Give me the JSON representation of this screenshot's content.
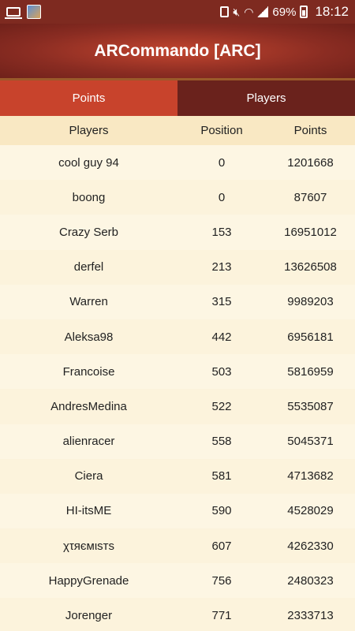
{
  "status_bar": {
    "battery": "69%",
    "time": "18:12"
  },
  "header": {
    "title": "ARCommando [ARC]"
  },
  "tabs": [
    {
      "label": "Points",
      "active": true
    },
    {
      "label": "Players",
      "active": false
    }
  ],
  "table": {
    "columns": [
      "Players",
      "Position",
      "Points"
    ],
    "rows": [
      {
        "player": "cool guy 94",
        "position": "0",
        "points": "1201668"
      },
      {
        "player": "boong",
        "position": "0",
        "points": "87607"
      },
      {
        "player": "Crazy Serb",
        "position": "153",
        "points": "16951012"
      },
      {
        "player": "derfel",
        "position": "213",
        "points": "13626508"
      },
      {
        "player": "Warren",
        "position": "315",
        "points": "9989203"
      },
      {
        "player": "Aleksa98",
        "position": "442",
        "points": "6956181"
      },
      {
        "player": "Francoise",
        "position": "503",
        "points": "5816959"
      },
      {
        "player": "AndresMedina",
        "position": "522",
        "points": "5535087"
      },
      {
        "player": "alienracer",
        "position": "558",
        "points": "5045371"
      },
      {
        "player": "Ciera",
        "position": "581",
        "points": "4713682"
      },
      {
        "player": "HI-itsME",
        "position": "590",
        "points": "4528029"
      },
      {
        "player": "χτяємιѕтѕ",
        "position": "607",
        "points": "4262330"
      },
      {
        "player": "HappyGrenade",
        "position": "756",
        "points": "2480323"
      },
      {
        "player": "Jorenger",
        "position": "771",
        "points": "2333713"
      }
    ]
  }
}
